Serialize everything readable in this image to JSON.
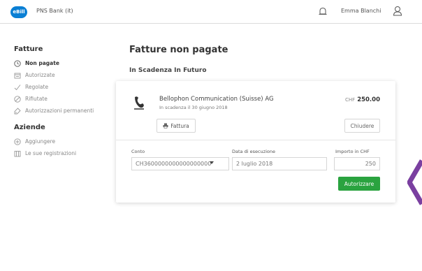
{
  "header": {
    "logo_text": "eBill",
    "bank_name": "PNS Bank (it)",
    "user_name": "Emma Blanchi"
  },
  "sidebar": {
    "section1_title": "Fatture",
    "items1": [
      {
        "label": "Non pagate",
        "icon": "clock-icon",
        "active": true
      },
      {
        "label": "Autorizzate",
        "icon": "calendar-icon",
        "active": false
      },
      {
        "label": "Regolate",
        "icon": "check-icon",
        "active": false
      },
      {
        "label": "Rifiutate",
        "icon": "ban-icon",
        "active": false
      },
      {
        "label": "Autorizzazioni permanenti",
        "icon": "tag-icon",
        "active": false
      }
    ],
    "section2_title": "Aziende",
    "items2": [
      {
        "label": "Aggiungere",
        "icon": "plus-circle-icon"
      },
      {
        "label": "Le sue registrazioni",
        "icon": "building-icon"
      }
    ]
  },
  "main": {
    "title": "Fatture non pagate",
    "subtitle": "In Scadenza In Futuro"
  },
  "bill": {
    "company": "Bellophon Communication (Suisse) AG",
    "due": "In scadenza il 30 giugno 2018",
    "currency": "CHF",
    "amount": "250.00",
    "invoice_button": "Fattura",
    "close_button": "Chiudere",
    "account_label": "Conto",
    "account_value": "CH3600000000000000000",
    "date_label": "Data di esecuzione",
    "date_value": "2 luglio 2018",
    "amount_label": "Importo in CHF",
    "amount_value": "250",
    "authorize_button": "Autorizzare"
  },
  "colors": {
    "accent_green": "#2aa33f",
    "logo_blue": "#0a7fd4",
    "arrow_purple": "#7a3fa0"
  }
}
